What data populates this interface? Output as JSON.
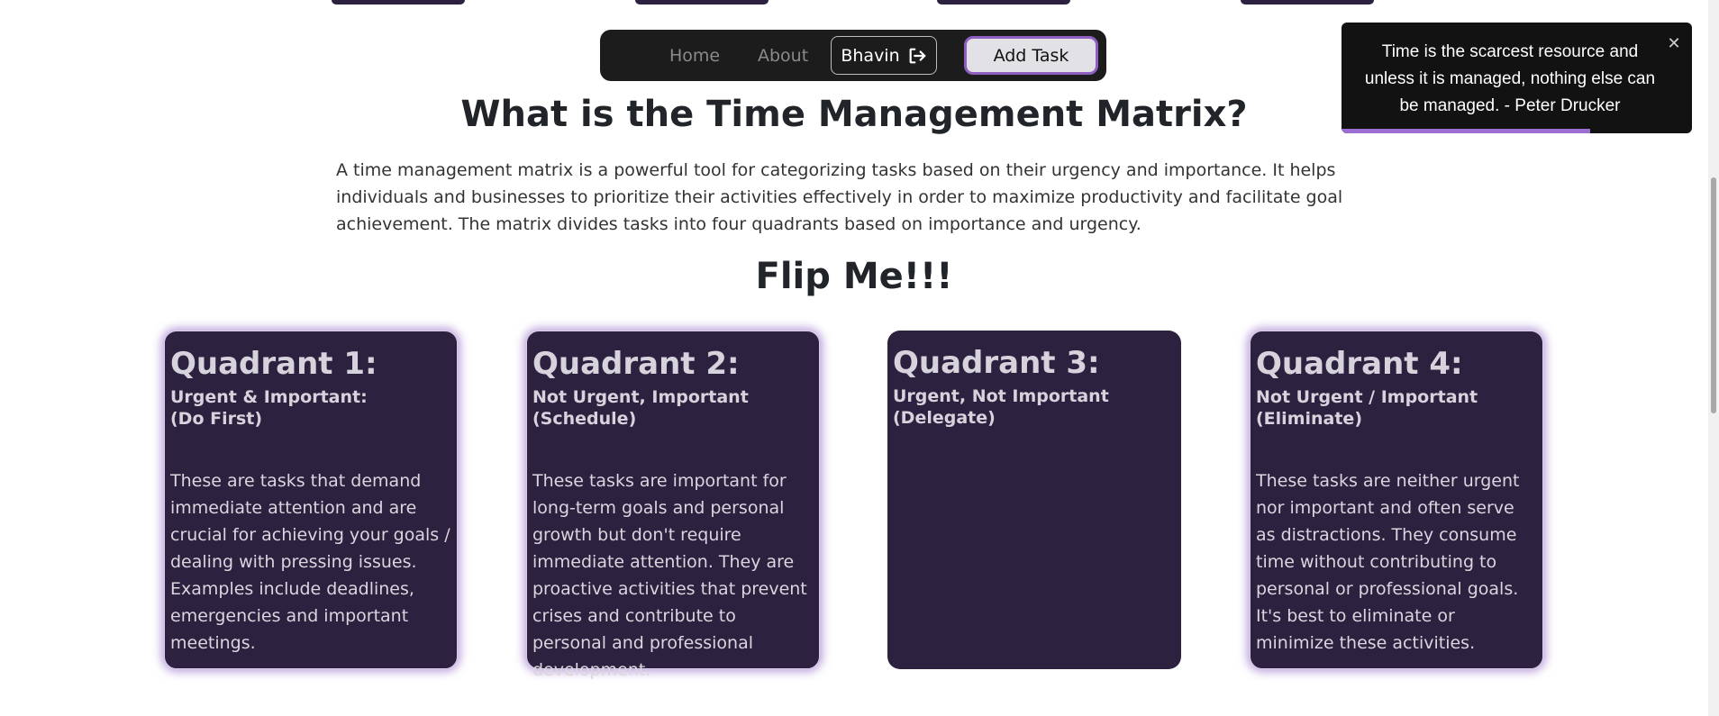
{
  "navbar": {
    "home_label": "Home",
    "about_label": "About",
    "user_label": "Bhavin",
    "add_task_label": "Add Task"
  },
  "main": {
    "title": "What is the Time Management Matrix?",
    "intro": "A time management matrix is a powerful tool for categorizing tasks based on their urgency and importance. It helps individuals and businesses to prioritize their activities effectively in order to maximize productivity and facilitate goal achievement. The matrix divides tasks into four quadrants based on importance and urgency.",
    "flip_title": "Flip Me!!!"
  },
  "quadrants": [
    {
      "title": "Quadrant 1:",
      "subtitle": "Urgent & Important:\n(Do First)",
      "body": "These are tasks that demand immediate attention and are crucial for achieving your goals / dealing with pressing issues. Examples include deadlines, emergencies and important meetings."
    },
    {
      "title": "Quadrant 2:",
      "subtitle": "Not Urgent, Important\n(Schedule)",
      "body": "These tasks are important for long-term goals and personal growth but don't require immediate attention. They are proactive activities that prevent crises and contribute to personal and professional development."
    },
    {
      "title": "Quadrant 3:",
      "subtitle": "Urgent, Not Important\n(Delegate)",
      "body": ""
    },
    {
      "title": "Quadrant 4:",
      "subtitle": "Not Urgent / Important\n(Eliminate)",
      "body": "These tasks are neither urgent nor important and often serve as distractions. They consume time without contributing to personal or professional goals. It's best to eliminate or minimize these activities."
    }
  ],
  "toast": {
    "message": "Time is the scarcest resource and unless it is managed, nothing else can be managed. - Peter Drucker",
    "close_icon": "close-icon",
    "progress_fraction": 0.71
  },
  "icons": {
    "logout": "logout-icon"
  },
  "colors": {
    "card_bg": "#2d2140",
    "navbar_bg": "#1c1c1c",
    "accent": "#9b6fd1"
  }
}
